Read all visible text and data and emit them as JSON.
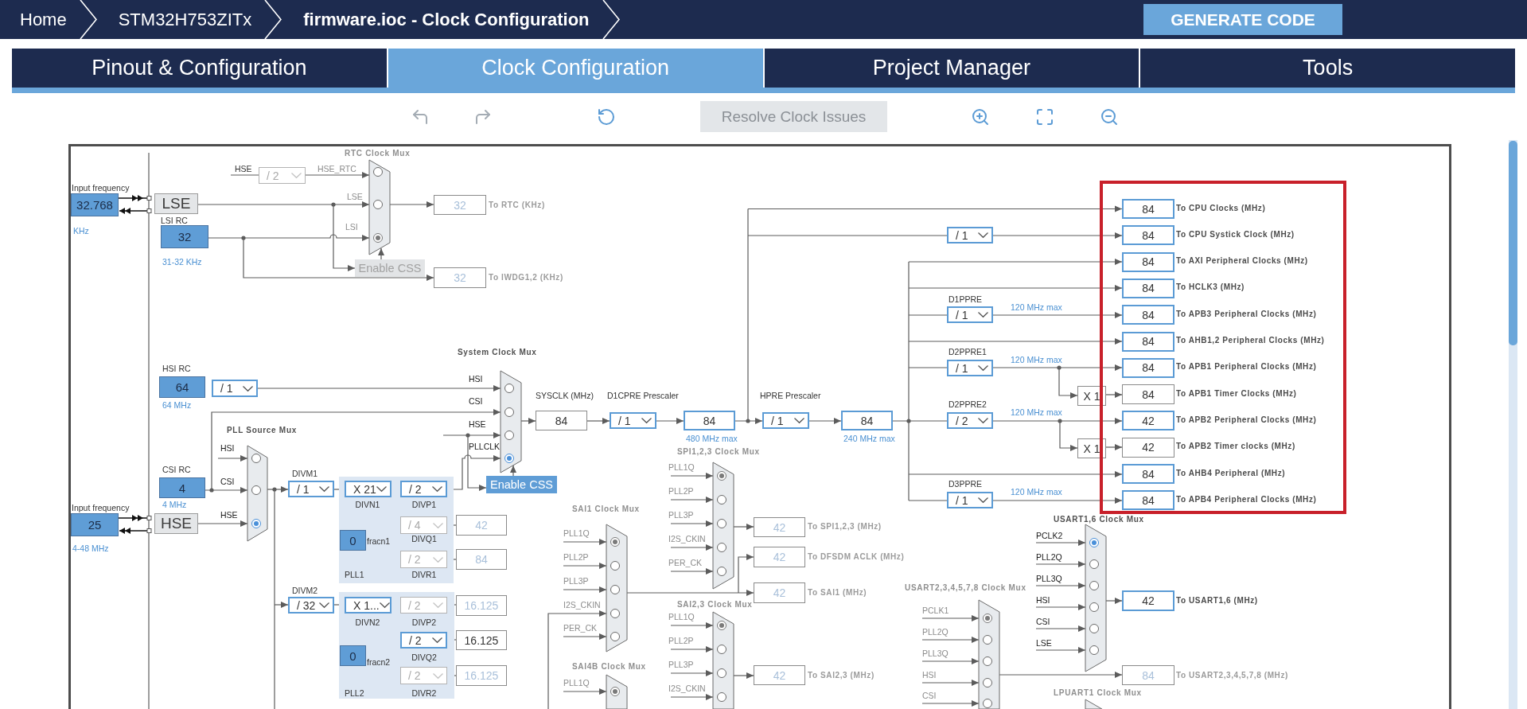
{
  "breadcrumb": [
    {
      "label": "Home",
      "current": false
    },
    {
      "label": "STM32H753ZITx",
      "current": false
    },
    {
      "label": "firmware.ioc - Clock Configuration",
      "current": true
    }
  ],
  "generate_button": {
    "label": "GENERATE CODE"
  },
  "tabs": [
    {
      "label": "Pinout & Configuration",
      "selected": false
    },
    {
      "label": "Clock Configuration",
      "selected": true
    },
    {
      "label": "Project Manager",
      "selected": false
    },
    {
      "label": "Tools",
      "selected": false
    }
  ],
  "toolbar": {
    "tools": [
      {
        "kind": "undo",
        "disabled": true
      },
      {
        "kind": "redo",
        "disabled": true
      },
      {
        "kind": "reset",
        "disabled": false
      },
      {
        "kind": "resolve",
        "label": "Resolve Clock Issues",
        "disabled": true
      },
      {
        "kind": "zoom_in",
        "disabled": false
      },
      {
        "kind": "fit",
        "disabled": false
      },
      {
        "kind": "zoom_out",
        "disabled": false
      }
    ]
  },
  "diagram": {
    "inputs": [
      {
        "caption": "Input frequency",
        "value": "32.768",
        "unit": "KHz",
        "oscillator": "LSE"
      },
      {
        "caption": "Input frequency",
        "value": "25",
        "unit": "4-48 MHz",
        "oscillator": "HSE"
      }
    ],
    "rc_oscillators": [
      {
        "name": "LSI RC",
        "value": "32",
        "unit": "31-32 KHz"
      },
      {
        "name": "HSI RC",
        "value": "64",
        "unit": "64 MHz"
      },
      {
        "name": "CSI RC",
        "value": "4",
        "unit": "4 MHz"
      }
    ],
    "muxes": [
      {
        "title": "RTC Clock Mux",
        "active": false,
        "inputs": [
          {
            "label": "HSE_RTC",
            "selected": false
          },
          {
            "label": "LSE",
            "selected": false
          },
          {
            "label": "LSI",
            "selected": true
          }
        ]
      },
      {
        "title": "System Clock Mux",
        "active": true,
        "inputs": [
          {
            "label": "HSI",
            "selected": false
          },
          {
            "label": "CSI",
            "selected": false
          },
          {
            "label": "HSE",
            "selected": false
          },
          {
            "label": "PLLCLK",
            "selected": true
          }
        ]
      },
      {
        "title": "PLL Source Mux",
        "active": true,
        "inputs": [
          {
            "label": "HSI",
            "selected": false
          },
          {
            "label": "CSI",
            "selected": false
          },
          {
            "label": "HSE",
            "selected": true
          }
        ]
      },
      {
        "title": "SPI1,2,3 Clock Mux",
        "active": false,
        "inputs": [
          {
            "label": "PLL1Q",
            "selected": true
          },
          {
            "label": "PLL2P",
            "selected": false
          },
          {
            "label": "PLL3P",
            "selected": false
          },
          {
            "label": "I2S_CKIN",
            "selected": false
          },
          {
            "label": "PER_CK",
            "selected": false
          }
        ]
      },
      {
        "title": "SAI1 Clock Mux",
        "active": false,
        "inputs": [
          {
            "label": "PLL1Q",
            "selected": true
          },
          {
            "label": "PLL2P",
            "selected": false
          },
          {
            "label": "PLL3P",
            "selected": false
          },
          {
            "label": "I2S_CKIN",
            "selected": false
          },
          {
            "label": "PER_CK",
            "selected": false
          }
        ]
      },
      {
        "title": "SAI2,3 Clock Mux",
        "active": false,
        "inputs": [
          {
            "label": "PLL1Q",
            "selected": true
          },
          {
            "label": "PLL2P",
            "selected": false
          },
          {
            "label": "PLL3P",
            "selected": false
          },
          {
            "label": "I2S_CKIN",
            "selected": false
          }
        ]
      },
      {
        "title": "SAI4B Clock Mux",
        "active": false,
        "inputs": [
          {
            "label": "PLL1Q",
            "selected": true
          }
        ]
      },
      {
        "title": "USART2,3,4,5,7,8 Clock Mux",
        "active": false,
        "inputs": [
          {
            "label": "PCLK1",
            "selected": true
          },
          {
            "label": "PLL2Q",
            "selected": false
          },
          {
            "label": "PLL3Q",
            "selected": false
          },
          {
            "label": "HSI",
            "selected": false
          },
          {
            "label": "CSI",
            "selected": false
          }
        ]
      },
      {
        "title": "USART1,6 Clock Mux",
        "active": true,
        "inputs": [
          {
            "label": "PCLK2",
            "selected": true
          },
          {
            "label": "PLL2Q",
            "selected": false
          },
          {
            "label": "PLL3Q",
            "selected": false
          },
          {
            "label": "HSI",
            "selected": false
          },
          {
            "label": "CSI",
            "selected": false
          },
          {
            "label": "LSE",
            "selected": false
          }
        ]
      },
      {
        "title": "LPUART1 Clock Mux",
        "active": false
      }
    ],
    "dividers": [
      {
        "caption": "HSE",
        "value": "/ 2",
        "disabled": true
      },
      {
        "value": "/ 1",
        "disabled": false
      },
      {
        "caption": "D1CPRE Prescaler",
        "value": "/ 1",
        "disabled": false
      },
      {
        "caption": "HPRE Prescaler",
        "value": "/ 1",
        "disabled": false
      },
      {
        "value": "/ 1",
        "disabled": false
      },
      {
        "caption": "D1PPRE",
        "value": "/ 1",
        "disabled": false,
        "note": "120 MHz max"
      },
      {
        "caption": "D2PPRE1",
        "value": "/ 1",
        "disabled": false,
        "note": "120 MHz max"
      },
      {
        "caption": "D2PPRE2",
        "value": "/ 2",
        "disabled": false,
        "note": "120 MHz max"
      },
      {
        "caption": "D3PPRE",
        "value": "/ 1",
        "disabled": false,
        "note": "120 MHz max"
      },
      {
        "caption": "DIVM1",
        "value": "/ 1",
        "disabled": false
      },
      {
        "caption": "DIVN1",
        "value": "X 21",
        "disabled": false
      },
      {
        "caption": "DIVP1",
        "value": "/ 2",
        "disabled": false
      },
      {
        "caption": "DIVQ1",
        "value": "/ 4",
        "disabled": true
      },
      {
        "caption": "DIVR1",
        "value": "/ 2",
        "disabled": true
      },
      {
        "caption": "DIVM2",
        "value": "/ 32",
        "disabled": false
      },
      {
        "caption": "DIVN2",
        "value": "X 1...",
        "disabled": false
      },
      {
        "caption": "DIVP2",
        "value": "/ 2",
        "disabled": true
      },
      {
        "caption": "DIVQ2",
        "value": "/ 2",
        "disabled": false
      },
      {
        "caption": "DIVR2",
        "value": "/ 2",
        "disabled": true
      }
    ],
    "pll_blocks": [
      {
        "name": "PLL1",
        "fraction_label": "fracn1",
        "fraction": "0"
      },
      {
        "name": "PLL2",
        "fraction_label": "fracn2",
        "fraction": "0"
      }
    ],
    "css_buttons": [
      {
        "label": "Enable CSS",
        "disabled": true
      },
      {
        "label": "Enable CSS",
        "disabled": false
      }
    ],
    "frequencies": [
      {
        "value": "32",
        "kind": "plain",
        "disabled": true,
        "label": "To RTC (KHz)"
      },
      {
        "value": "32",
        "kind": "plain",
        "disabled": true,
        "label": "To IWDG1,2 (KHz)"
      },
      {
        "value": "84",
        "kind": "plain",
        "disabled": false,
        "caption": "SYSCLK (MHz)"
      },
      {
        "value": "84",
        "kind": "output",
        "disabled": false,
        "note": "480 MHz max"
      },
      {
        "value": "84",
        "kind": "output",
        "disabled": false,
        "note": "240 MHz max"
      },
      {
        "value": "42",
        "kind": "plain",
        "disabled": true
      },
      {
        "value": "84",
        "kind": "plain",
        "disabled": true
      },
      {
        "value": "16.125",
        "kind": "plain",
        "disabled": true
      },
      {
        "value": "16.125",
        "kind": "plain",
        "disabled": false
      },
      {
        "value": "16.125",
        "kind": "plain",
        "disabled": true
      },
      {
        "value": "42",
        "kind": "plain",
        "disabled": true,
        "label": "To SPI1,2,3 (MHz)"
      },
      {
        "value": "42",
        "kind": "plain",
        "disabled": true,
        "label": "To DFSDM ACLK (MHz)"
      },
      {
        "value": "42",
        "kind": "plain",
        "disabled": true,
        "label": "To SAI1 (MHz)"
      },
      {
        "value": "42",
        "kind": "plain",
        "disabled": true,
        "label": "To SAI2,3 (MHz)"
      },
      {
        "value": "X 1",
        "kind": "multiplier",
        "disabled": false
      },
      {
        "value": "X 1",
        "kind": "multiplier",
        "disabled": false
      },
      {
        "value": "84",
        "kind": "output",
        "disabled": false,
        "label": "To CPU Clocks (MHz)"
      },
      {
        "value": "84",
        "kind": "output",
        "disabled": false,
        "label": "To CPU Systick Clock (MHz)"
      },
      {
        "value": "84",
        "kind": "output",
        "disabled": false,
        "label": "To AXI Peripheral Clocks (MHz)"
      },
      {
        "value": "84",
        "kind": "output",
        "disabled": false,
        "label": "To HCLK3 (MHz)"
      },
      {
        "value": "84",
        "kind": "output",
        "disabled": false,
        "label": "To APB3 Peripheral Clocks (MHz)"
      },
      {
        "value": "84",
        "kind": "output",
        "disabled": false,
        "label": "To AHB1,2 Peripheral Clocks (MHz)"
      },
      {
        "value": "84",
        "kind": "output",
        "disabled": false,
        "label": "To APB1 Peripheral Clocks (MHz)"
      },
      {
        "value": "84",
        "kind": "plain",
        "disabled": false,
        "label": "To APB1 Timer Clocks (MHz)"
      },
      {
        "value": "42",
        "kind": "output",
        "disabled": false,
        "label": "To APB2 Peripheral Clocks (MHz)"
      },
      {
        "value": "42",
        "kind": "plain",
        "disabled": false,
        "label": "To APB2 Timer clocks (MHz)"
      },
      {
        "value": "84",
        "kind": "output",
        "disabled": false,
        "label": "To AHB4 Peripheral (MHz)"
      },
      {
        "value": "84",
        "kind": "output",
        "disabled": false,
        "label": "To APB4 Peripheral Clocks (MHz)"
      },
      {
        "value": "42",
        "kind": "output",
        "disabled": false,
        "label": "To USART1,6 (MHz)"
      },
      {
        "value": "84",
        "kind": "plain",
        "disabled": true,
        "label": "To USART2,3,4,5,7,8 (MHz)"
      }
    ]
  }
}
